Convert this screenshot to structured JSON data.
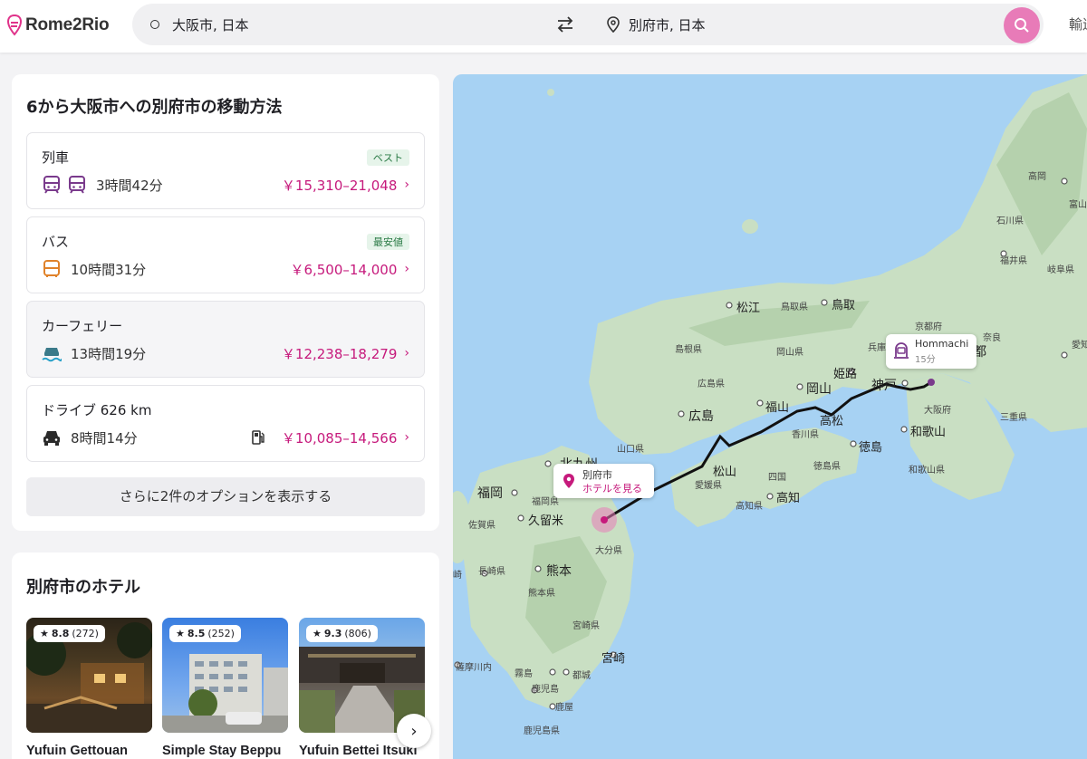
{
  "header": {
    "logo": "Rome2Rio",
    "origin": "大阪市, 日本",
    "destination": "別府市, 日本",
    "right_text": "輸送"
  },
  "routes_panel": {
    "title": "6から大阪市への別府市の移動方法",
    "routes": [
      {
        "name": "列車",
        "badge": "ベスト",
        "time": "3時間42分",
        "price": "￥15,310–21,048",
        "icons": [
          "train-icon",
          "train-icon"
        ]
      },
      {
        "name": "バス",
        "badge": "最安値",
        "time": "10時間31分",
        "price": "￥6,500–14,000",
        "icons": [
          "bus-icon"
        ]
      },
      {
        "name": "カーフェリー",
        "badge": "",
        "time": "13時間19分",
        "price": "￥12,238–18,279",
        "icons": [
          "car-ferry-icon"
        ]
      },
      {
        "name": "ドライブ 626 km",
        "badge": "",
        "time": "8時間14分",
        "price": "￥10,085–14,566",
        "icons": [
          "car-icon"
        ]
      }
    ],
    "more_options": "さらに2件のオプションを表示する"
  },
  "hotels_panel": {
    "title": "別府市のホテル",
    "hotels": [
      {
        "name": "Yufuin Gettouan",
        "score": "8.8",
        "reviews": "(272)"
      },
      {
        "name": "Simple Stay Beppu",
        "score": "8.5",
        "reviews": "(252)"
      },
      {
        "name": "Yufuin Bettei Itsuki",
        "score": "9.3",
        "reviews": "(806)"
      }
    ]
  },
  "map": {
    "popup_beppu": {
      "title": "別府市",
      "link": "ホテルを見る"
    },
    "popup_hommachi": {
      "title": "Hommachi",
      "duration": "15分"
    },
    "labels": {
      "matsue": "松江",
      "tottori_ken": "鳥取県",
      "tottori": "鳥取",
      "shimane": "島根県",
      "okayama_ken": "岡山県",
      "hyogo": "兵庫",
      "kyoto_fu": "京都府",
      "kyoto": "都",
      "hiroshima_ken": "広島県",
      "himeji": "姫路",
      "okayama": "岡山",
      "kobe": "神戸",
      "osaka_fu": "大阪府",
      "fukuyama": "福山",
      "hiroshima": "広島",
      "takamatsu": "高松",
      "kagawa": "香川県",
      "wakayama": "和歌山",
      "mie": "三重県",
      "yamaguchi": "山口県",
      "tokushima": "徳島",
      "kitakyushu": "北九州",
      "matsuyama": "松山",
      "tokushima_ken": "徳島県",
      "shikoku": "四国",
      "wakayama_ken": "和歌山県",
      "ehime": "愛媛県",
      "fukuoka": "福岡",
      "fukuoka_ken": "福岡県",
      "kochi": "高知",
      "kochi_ken": "高知県",
      "saga": "佐賀県",
      "kurume": "久留米",
      "oita": "大分県",
      "nagasaki": "長崎県",
      "kumamoto": "熊本",
      "kumamoto_ken": "熊本県",
      "miyazaki_ken": "宮崎県",
      "miyazaki": "宮崎",
      "satsumasendai": "薩摩川内",
      "kirishima": "霧島",
      "miyakonojo": "都城",
      "kagoshima": "鹿児島",
      "kanoya": "鹿屋",
      "kagoshima_ken": "鹿児島県",
      "takaoka": "高岡",
      "toyama": "富山県",
      "ishikawa": "石川県",
      "fukui": "福井県",
      "gifu": "岐阜県",
      "aichi": "愛知",
      "nara": "奈良",
      "kyoto_edge": "崎"
    }
  }
}
